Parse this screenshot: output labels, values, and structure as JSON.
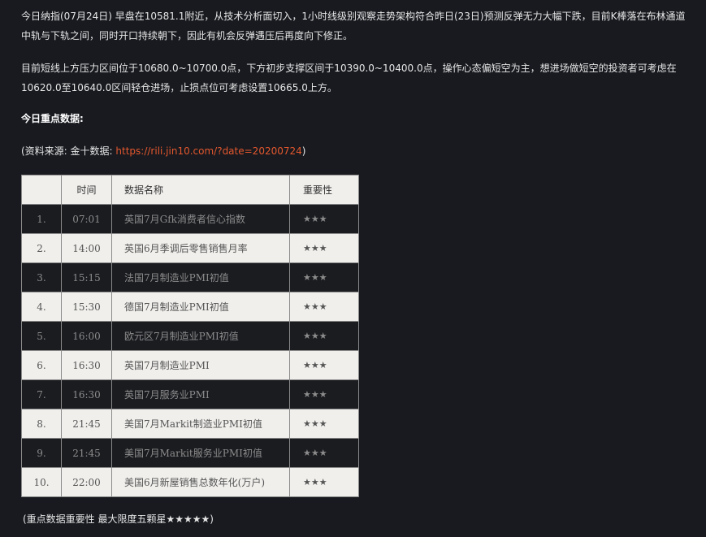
{
  "article": {
    "paragraph1": "今日纳指(07月24日) 早盘在10581.1附近，从技术分析面切入，1小时线级别观察走势架构符合昨日(23日)预测反弹无力大幅下跌，目前K棒落在布林通道中轨与下轨之间，同时开口持续朝下，因此有机会反弹遇压后再度向下修正。",
    "paragraph2": "目前短线上方压力区间位于10680.0~10700.0点，下方初步支撑区间于10390.0~10400.0点，操作心态偏短空为主，想进场做短空的投资者可考虑在10620.0至10640.0区间轻仓进场，止损点位可考虑设置10665.0上方。",
    "heading": "今日重点数据:",
    "source_prefix": "(资料来源: 金十数据: ",
    "source_link": "https://rili.jin10.com/?date=20200724",
    "source_suffix": ")",
    "footnote": "(重点数据重要性 最大限度五颗星★★★★★)"
  },
  "table": {
    "headers": {
      "no": "",
      "time": "时间",
      "name": "数据名称",
      "importance": "重要性"
    },
    "rows": [
      {
        "no": "1.",
        "time": "07:01",
        "name": "英国7月Gfk消费者信心指数",
        "importance": "★★★"
      },
      {
        "no": "2.",
        "time": "14:00",
        "name": "英国6月季调后零售销售月率",
        "importance": "★★★"
      },
      {
        "no": "3.",
        "time": "15:15",
        "name": "法国7月制造业PMI初值",
        "importance": "★★★"
      },
      {
        "no": "4.",
        "time": "15:30",
        "name": "德国7月制造业PMI初值",
        "importance": "★★★"
      },
      {
        "no": "5.",
        "time": "16:00",
        "name": "欧元区7月制造业PMI初值",
        "importance": "★★★"
      },
      {
        "no": "6.",
        "time": "16:30",
        "name": "英国7月制造业PMI",
        "importance": "★★★"
      },
      {
        "no": "7.",
        "time": "16:30",
        "name": "英国7月服务业PMI",
        "importance": "★★★"
      },
      {
        "no": "8.",
        "time": "21:45",
        "name": "美国7月Markit制造业PMI初值",
        "importance": "★★★"
      },
      {
        "no": "9.",
        "time": "21:45",
        "name": "美国7月Markit服务业PMI初值",
        "importance": "★★★"
      },
      {
        "no": "10.",
        "time": "22:00",
        "name": "美国6月新屋销售总数年化(万户)",
        "importance": "★★★"
      }
    ]
  },
  "colors": {
    "background": "#181a1f",
    "link": "#e4572e",
    "light_row": "#f0efec",
    "dark_row": "#1b1c20"
  }
}
